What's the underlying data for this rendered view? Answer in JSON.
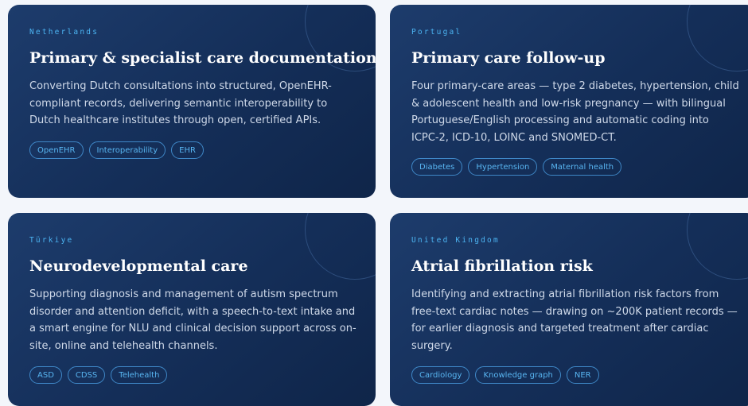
{
  "cards": [
    {
      "country": "Netherlands",
      "title": "Primary & specialist care documentation",
      "description": "Converting Dutch consultations into structured, OpenEHR-compliant records, delivering semantic interoperability to Dutch healthcare institutes through open, certified APIs.",
      "tags": [
        "OpenEHR",
        "Interoperability",
        "EHR"
      ]
    },
    {
      "country": "Portugal",
      "title": "Primary care follow-up",
      "description": "Four primary-care areas — type 2 diabetes, hypertension, child & adolescent health and low-risk pregnancy — with bilingual Portuguese/English processing and automatic coding into ICPC-2, ICD-10, LOINC and SNOMED-CT.",
      "tags": [
        "Diabetes",
        "Hypertension",
        "Maternal health"
      ]
    },
    {
      "country": "Türkiye",
      "title": "Neurodevelopmental care",
      "description": "Supporting diagnosis and management of autism spectrum disorder and attention deficit, with a speech-to-text intake and a smart engine for NLU and clinical decision support across on-site, online and telehealth channels.",
      "tags": [
        "ASD",
        "CDSS",
        "Telehealth"
      ]
    },
    {
      "country": "United Kingdom",
      "title": "Atrial fibrillation risk",
      "description": "Identifying and extracting atrial fibrillation risk factors from free-text cardiac notes — drawing on ~200K patient records — for earlier diagnosis and targeted treatment after cardiac surgery.",
      "tags": [
        "Cardiology",
        "Knowledge graph",
        "NER"
      ]
    }
  ]
}
